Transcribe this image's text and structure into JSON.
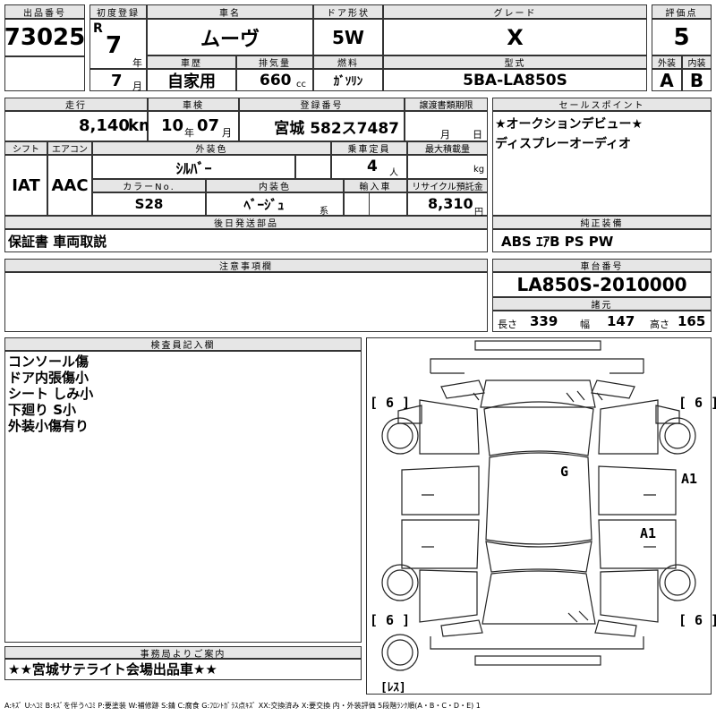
{
  "header": {
    "lot_label": "出品番号",
    "lot": "73025",
    "reg_label": "初度登録",
    "era": "R",
    "reg_year": "7",
    "year_unit": "年",
    "reg_month": "7",
    "month_unit": "月",
    "model_label": "車名",
    "model": "ムーヴ",
    "door_label": "ドア形状",
    "door": "5W",
    "grade_label": "グレード",
    "grade": "X",
    "score_label": "評価点",
    "score": "5",
    "history_label": "車歴",
    "history": "自家用",
    "displacement_label": "排気量",
    "displacement": "660",
    "cc": "cc",
    "fuel_label": "燃料",
    "fuel": "ｶﾞｿﾘﾝ",
    "type_label": "型式",
    "type": "5BA-LA850S",
    "ext_label": "外装",
    "ext": "A",
    "int_label": "内装",
    "int": "B"
  },
  "row2": {
    "mileage_label": "走行",
    "mileage": "8,140",
    "km": "km",
    "inspection_label": "車検",
    "insp_year": "10",
    "insp_year_unit": "年",
    "insp_month": "07",
    "insp_month_unit": "月",
    "plate_label": "登録番号",
    "plate": "宮城 582ス7487",
    "transfer_label": "譲渡書類期限",
    "transfer_month": "月",
    "transfer_day": "日",
    "shift_label": "シフト",
    "shift": "IAT",
    "ac_label": "エアコン",
    "ac": "AAC",
    "color_label": "外装色",
    "color": "ｼﾙﾊﾞｰ",
    "capacity_label": "乗車定員",
    "capacity": "4",
    "capacity_unit": "人",
    "load_label": "最大積載量",
    "load_unit": "kg",
    "color_no_label": "カラーNo.",
    "color_no": "S28",
    "interior_color_label": "内装色",
    "interior_color": "ﾍﾞｰｼﾞｭ",
    "interior_color_suffix": "系",
    "import_label": "輸入車",
    "recycle_label": "リサイクル預託金",
    "recycle": "8,310",
    "yen": "円"
  },
  "sales_point": {
    "label": "セールスポイント",
    "lines": [
      "★オークションデビュー★",
      "ディスプレーオーディオ"
    ]
  },
  "later_parts": {
    "label": "後日発送部品",
    "value": "保証書 車両取説"
  },
  "genuine_equipment": {
    "label": "純正装備",
    "value": "ABS ｴｱB PS PW"
  },
  "caution": {
    "label": "注意事項欄"
  },
  "chassis": {
    "label": "車台番号",
    "value": "LA850S-2010000",
    "spec_label": "諸元",
    "length_label": "長さ",
    "length": "339",
    "width_label": "幅",
    "width": "147",
    "height_label": "高さ",
    "height": "165"
  },
  "inspector": {
    "label": "検査員記入欄",
    "lines": [
      "コンソール傷",
      "ドア内張傷小",
      "シート しみ小",
      "下廻り S小",
      "外装小傷有り"
    ]
  },
  "diagram": {
    "mark_tl": "[ 6 ]",
    "mark_tr": "[ 6 ]",
    "mark_bl": "[ 6 ]",
    "mark_br": "[ 6 ]",
    "mark_g": "G",
    "mark_a1_right": "A1",
    "mark_a1_body": "A1",
    "mark_rear": "[ﾚｽ]"
  },
  "office": {
    "label": "事務局よりご案内",
    "value": "★★宮城サテライト会場出品車★★"
  },
  "legend": "A:ｷｽﾞ U:ﾍｺﾐ B:ｷｽﾞを伴うﾍｺﾐ P:要塗装 W:補修跡 S:錆 C:腐食 G:ﾌﾛﾝﾄｶﾞﾗｽ点ｷｽﾞ XX:交換済み X:要交換 内・外装評価 5段階ﾗﾝｸ順(A・B・C・D・E) 1"
}
